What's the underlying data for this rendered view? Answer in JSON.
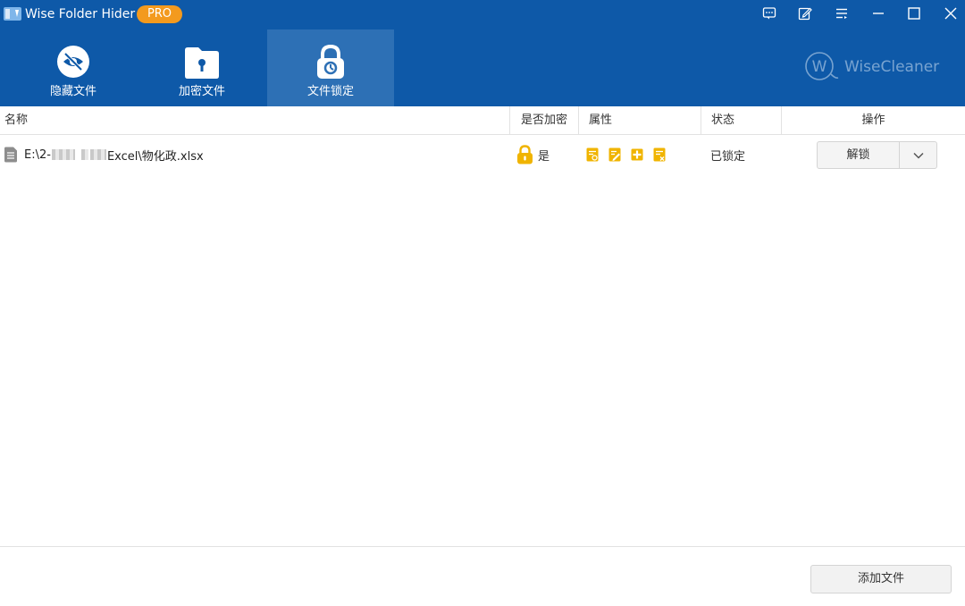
{
  "app": {
    "title": "Wise Folder Hider",
    "badge": "PRO"
  },
  "titlebar": {
    "icons": [
      "feedback-icon",
      "edit-icon",
      "menu-icon",
      "minimize-icon",
      "maximize-icon",
      "close-icon"
    ]
  },
  "tabs": [
    {
      "label": "隐藏文件",
      "icon": "eye-slash-icon",
      "active": false
    },
    {
      "label": "加密文件",
      "icon": "folder-key-icon",
      "active": false
    },
    {
      "label": "文件锁定",
      "icon": "lock-icon",
      "active": true
    }
  ],
  "brand": {
    "text": "WiseCleaner",
    "mark": "W"
  },
  "table": {
    "columns": [
      "名称",
      "是否加密",
      "属性",
      "状态",
      "操作"
    ],
    "rows": [
      {
        "path_prefix": "E:\\2-",
        "path_suffix": "Excel\\物化政.xlsx",
        "encrypted": "是",
        "attributes": [
          "read-attr-icon",
          "write-attr-icon",
          "delete-attr-icon",
          "exec-attr-icon"
        ],
        "status": "已锁定",
        "action": "解锁"
      }
    ]
  },
  "footer": {
    "add_button": "添加文件"
  },
  "colors": {
    "header": "#0e59a8",
    "active_tab": "#2d70b5",
    "accent": "#f39a1e",
    "attr_yellow": "#f0b400"
  }
}
